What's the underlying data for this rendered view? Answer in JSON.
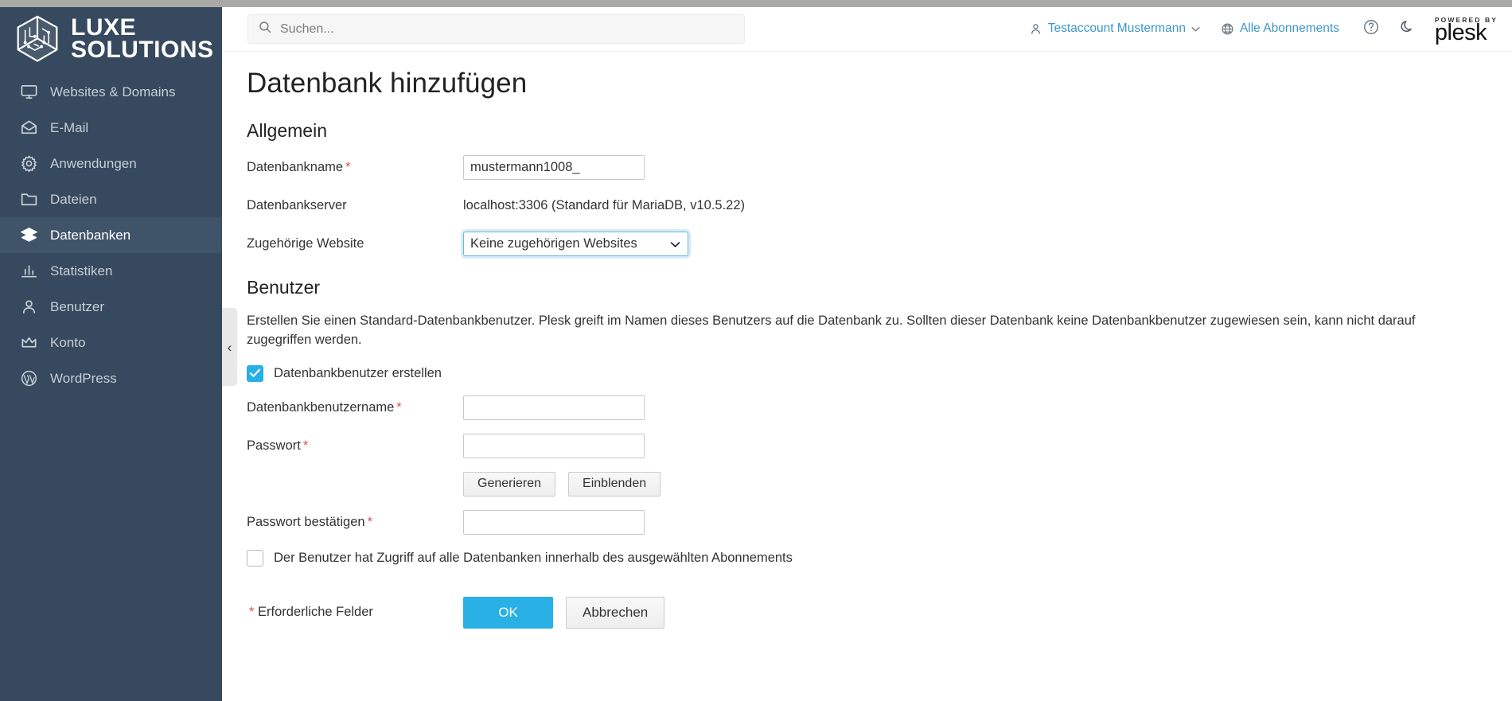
{
  "brand": {
    "logo_line1": "LUXE",
    "logo_line2": "SOLUTIONS",
    "logo_icon": "cube-circuit-icon"
  },
  "sidebar": {
    "items": [
      {
        "label": "Websites & Domains",
        "icon": "monitor-icon",
        "active": false
      },
      {
        "label": "E-Mail",
        "icon": "envelope-icon",
        "active": false
      },
      {
        "label": "Anwendungen",
        "icon": "gear-icon",
        "active": false
      },
      {
        "label": "Dateien",
        "icon": "folder-icon",
        "active": false
      },
      {
        "label": "Datenbanken",
        "icon": "layers-icon",
        "active": true
      },
      {
        "label": "Statistiken",
        "icon": "bar-chart-icon",
        "active": false
      },
      {
        "label": "Benutzer",
        "icon": "user-icon",
        "active": false
      },
      {
        "label": "Konto",
        "icon": "crown-icon",
        "active": false
      },
      {
        "label": "WordPress",
        "icon": "wordpress-icon",
        "active": false
      }
    ],
    "collapse_label": "‹"
  },
  "header": {
    "search_placeholder": "Suchen...",
    "search_value": "",
    "search_icon": "search-icon",
    "account_name": "Testaccount Mustermann",
    "account_icon": "user-icon",
    "account_caret": "⌄",
    "subscriptions_label": "Alle Abonnements",
    "subscriptions_icon": "globe-icon",
    "help_icon": "question-circle-icon",
    "theme_icon": "moon-icon",
    "powered_by": "POWERED BY",
    "product": "plesk"
  },
  "main": {
    "page_title": "Datenbank hinzufügen",
    "general": {
      "section_title": "Allgemein",
      "db_name_label": "Datenbankname",
      "db_name_value": "mustermann1008_",
      "db_name_placeholder": "",
      "db_server_label": "Datenbankserver",
      "db_server_value": "localhost:3306 (Standard für MariaDB, v10.5.22)",
      "website_label": "Zugehörige Website",
      "website_selected": "Keine zugehörigen Websites",
      "website_options": [
        "Keine zugehörigen Websites"
      ]
    },
    "user": {
      "section_title": "Benutzer",
      "description": "Erstellen Sie einen Standard-Datenbankbenutzer. Plesk greift im Namen dieses Benutzers auf die Datenbank zu. Sollten dieser Datenbank keine Datenbankbenutzer zugewiesen sein, kann nicht darauf zugegriffen werden.",
      "create_user_label": "Datenbankbenutzer erstellen",
      "create_user_checked": true,
      "username_label": "Datenbankbenutzername",
      "username_value": "",
      "password_label": "Passwort",
      "password_value": "",
      "generate_label": "Generieren",
      "show_label": "Einblenden",
      "confirm_password_label": "Passwort bestätigen",
      "confirm_password_value": "",
      "access_all_label": "Der Benutzer hat Zugriff auf alle Datenbanken innerhalb des ausgewählten Abonnements",
      "access_all_checked": false
    },
    "footer": {
      "required_note": "Erforderliche Felder",
      "required_marker": "*",
      "ok_label": "OK",
      "cancel_label": "Abbrechen"
    },
    "required_marker": "*"
  },
  "colors": {
    "sidebar_bg": "#36495e",
    "sidebar_active": "#3f5369",
    "accent": "#29b0e4",
    "link": "#3c97c8",
    "required": "#d9534f"
  }
}
